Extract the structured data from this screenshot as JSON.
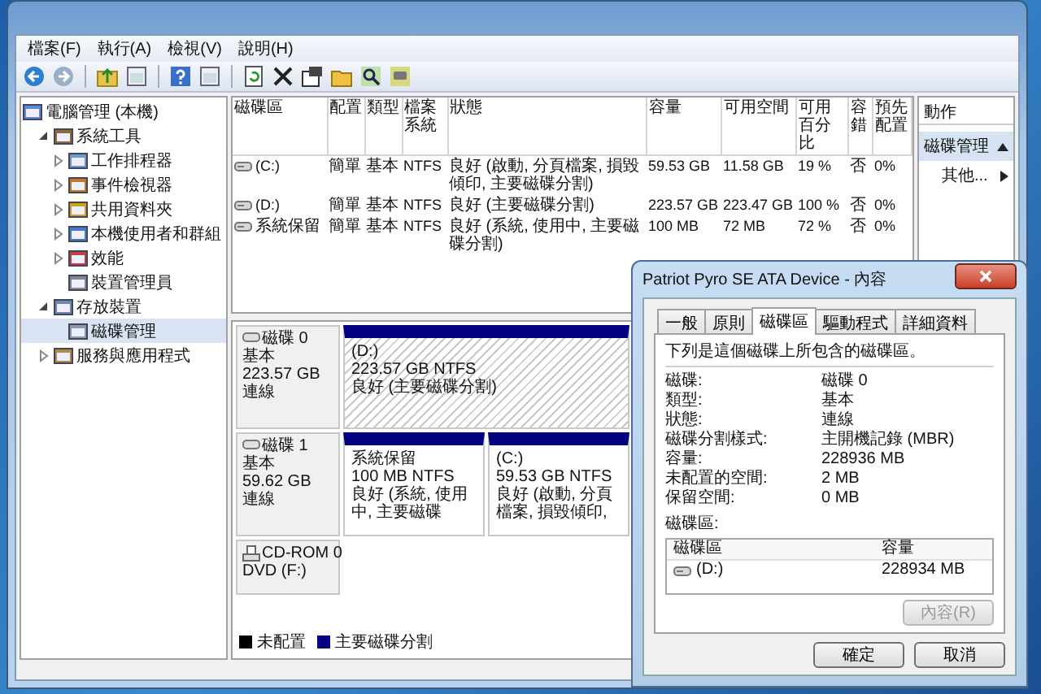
{
  "menu": [
    {
      "label": "檔案(F)"
    },
    {
      "label": "執行(A)"
    },
    {
      "label": "檢視(V)"
    },
    {
      "label": "說明(H)"
    }
  ],
  "tree": [
    {
      "label": "電腦管理 (本機)",
      "selected": false,
      "children": [
        {
          "label": "系統工具",
          "expanded": true,
          "selected": false,
          "children": [
            {
              "label": "工作排程器",
              "expanded": false,
              "selected": false
            },
            {
              "label": "事件檢視器",
              "expanded": false,
              "selected": false
            },
            {
              "label": "共用資料夾",
              "expanded": false,
              "selected": false
            },
            {
              "label": "本機使用者和群組",
              "expanded": false,
              "selected": false
            },
            {
              "label": "效能",
              "expanded": false,
              "selected": false
            },
            {
              "label": "裝置管理員",
              "selected": false
            }
          ]
        },
        {
          "label": "存放裝置",
          "expanded": true,
          "selected": false,
          "children": [
            {
              "label": "磁碟管理",
              "selected": true
            }
          ]
        },
        {
          "label": "服務與應用程式",
          "expanded": false,
          "selected": false
        }
      ]
    }
  ],
  "volumes": {
    "columns": [
      "磁碟區",
      "配置",
      "類型",
      "檔案系統",
      "狀態",
      "容量",
      "可用空間",
      "可用百分比",
      "容錯",
      "預先配置"
    ],
    "rows": [
      {
        "cells": [
          "(C:)",
          "簡單",
          "基本",
          "NTFS",
          "良好 (啟動, 分頁檔案, 損毀傾印, 主要磁碟分割)",
          "59.53 GB",
          "11.58 GB",
          "19 %",
          "否",
          "0%"
        ]
      },
      {
        "cells": [
          "(D:)",
          "簡單",
          "基本",
          "NTFS",
          "良好 (主要磁碟分割)",
          "223.57 GB",
          "223.47 GB",
          "100 %",
          "否",
          "0%"
        ]
      },
      {
        "cells": [
          "系統保留",
          "簡單",
          "基本",
          "NTFS",
          "良好 (系統, 使用中, 主要磁碟分割)",
          "100 MB",
          "72 MB",
          "72 %",
          "否",
          "0%"
        ]
      }
    ]
  },
  "disks": [
    {
      "kind": "disk",
      "name": "磁碟 0",
      "lines": [
        "基本",
        "223.57 GB",
        "連線"
      ],
      "partitions": [
        {
          "lines": [
            "(D:)",
            "223.57 GB NTFS",
            "良好 (主要磁碟分割)"
          ],
          "selected": true
        }
      ]
    },
    {
      "kind": "disk",
      "name": "磁碟 1",
      "lines": [
        "基本",
        "59.62 GB",
        "連線"
      ],
      "partitions": [
        {
          "lines": [
            "系統保留",
            "100 MB NTFS",
            "良好 (系統, 使用中, 主要磁碟"
          ],
          "selected": false
        },
        {
          "lines": [
            "(C:)",
            "59.53 GB NTFS",
            "良好 (啟動, 分頁檔案, 損毀傾印,"
          ],
          "selected": false
        }
      ]
    },
    {
      "kind": "cdrom",
      "name": "CD-ROM 0",
      "lines": [
        "DVD (F:)"
      ]
    }
  ],
  "legend": [
    {
      "label": "未配置",
      "color": "#000000"
    },
    {
      "label": "主要磁碟分割",
      "color": "#000080"
    }
  ],
  "actions": {
    "title": "動作",
    "sections": [
      {
        "label": "磁碟管理",
        "items": [
          {
            "label": "其他..."
          }
        ]
      }
    ]
  },
  "dialog": {
    "title": "Patriot Pyro SE ATA Device - 內容",
    "tabs": [
      {
        "label": "一般",
        "selected": false
      },
      {
        "label": "原則",
        "selected": false
      },
      {
        "label": "磁碟區",
        "selected": true
      },
      {
        "label": "驅動程式",
        "selected": false
      },
      {
        "label": "詳細資料",
        "selected": false
      }
    ],
    "intro": "下列是這個磁碟上所包含的磁碟區。",
    "fields": [
      {
        "label": "磁碟:",
        "value": "磁碟 0"
      },
      {
        "label": "類型:",
        "value": "基本"
      },
      {
        "label": "狀態:",
        "value": "連線"
      },
      {
        "label": "磁碟分割樣式:",
        "value": "主開機記錄 (MBR)"
      },
      {
        "label": "容量:",
        "value": "228936 MB"
      },
      {
        "label": "未配置的空間:",
        "value": "2 MB"
      },
      {
        "label": "保留空間:",
        "value": "0 MB"
      }
    ],
    "list_label": "磁碟區:",
    "list": {
      "columns": [
        "磁碟區",
        "容量"
      ],
      "rows": [
        {
          "cells": [
            "(D:)",
            "228934 MB"
          ]
        }
      ]
    },
    "properties_button": {
      "label": "內容(R)",
      "disabled": true
    },
    "buttons": [
      {
        "label": "確定"
      },
      {
        "label": "取消"
      }
    ]
  }
}
